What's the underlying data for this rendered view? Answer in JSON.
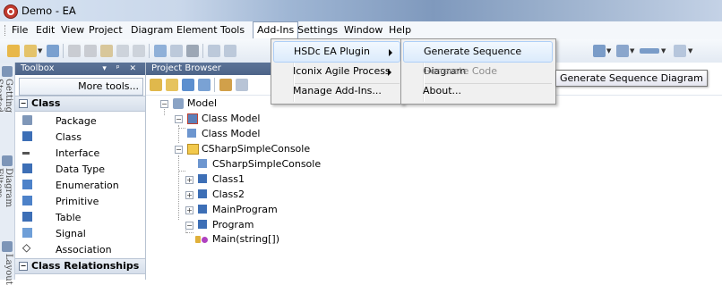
{
  "window": {
    "title": "Demo - EA"
  },
  "menubar": {
    "items": [
      "File",
      "Edit",
      "View",
      "Project",
      "Diagram",
      "Element",
      "Tools",
      "Add-Ins",
      "Settings",
      "Window",
      "Help"
    ],
    "active": "Add-Ins"
  },
  "addins_menu": {
    "items": [
      {
        "label": "HSDc EA Plugin",
        "has_submenu": true,
        "highlighted": true
      },
      {
        "label": "Iconix Agile Process",
        "has_submenu": true,
        "highlighted": false
      },
      {
        "label": "Manage Add-Ins...",
        "has_submenu": false,
        "highlighted": false
      }
    ]
  },
  "plugin_submenu": {
    "items": [
      {
        "label": "Generate Sequence Diagram",
        "highlighted": true,
        "disabled": false
      },
      {
        "label": "Generate Code",
        "highlighted": false,
        "disabled": true
      },
      {
        "label": "About...",
        "highlighted": false,
        "disabled": false
      }
    ]
  },
  "tooltip": {
    "text": "Generate Sequence Diagram"
  },
  "side_tabs": [
    "Getting Started",
    "Diagram Filters",
    "Layout"
  ],
  "toolbox": {
    "title": "Toolbox",
    "more_tools": "More tools...",
    "sections": [
      {
        "name": "Class",
        "items": [
          {
            "label": "Package",
            "icon": "package-icon"
          },
          {
            "label": "Class",
            "icon": "class-icon"
          },
          {
            "label": "Interface",
            "icon": "interface-icon"
          },
          {
            "label": "Data Type",
            "icon": "datatype-icon"
          },
          {
            "label": "Enumeration",
            "icon": "enumeration-icon"
          },
          {
            "label": "Primitive",
            "icon": "primitive-icon"
          },
          {
            "label": "Table",
            "icon": "table-icon"
          },
          {
            "label": "Signal",
            "icon": "signal-icon"
          },
          {
            "label": "Association",
            "icon": "association-icon"
          }
        ]
      },
      {
        "name": "Class Relationships",
        "items": []
      }
    ]
  },
  "project_browser": {
    "title": "Project Browser",
    "tree": [
      {
        "label": "Model",
        "icon": "model-icon"
      },
      {
        "label": "Class Model",
        "icon": "package-icon"
      },
      {
        "label": "Class Model",
        "icon": "diagram-icon"
      },
      {
        "label": "CSharpSimpleConsole",
        "icon": "folder-icon"
      },
      {
        "label": "CSharpSimpleConsole",
        "icon": "diagram-icon"
      },
      {
        "label": "Class1",
        "icon": "class-icon"
      },
      {
        "label": "Class2",
        "icon": "class-icon"
      },
      {
        "label": "MainProgram",
        "icon": "class-icon"
      },
      {
        "label": "Program",
        "icon": "class-icon"
      },
      {
        "label": "Main(string[])",
        "icon": "operation-icon"
      }
    ]
  },
  "colors": {
    "pane_header": "#4d6488",
    "highlight": "#dcebfc",
    "class_icon": "#3d6fb6",
    "folder_icon": "#f2c94c"
  }
}
